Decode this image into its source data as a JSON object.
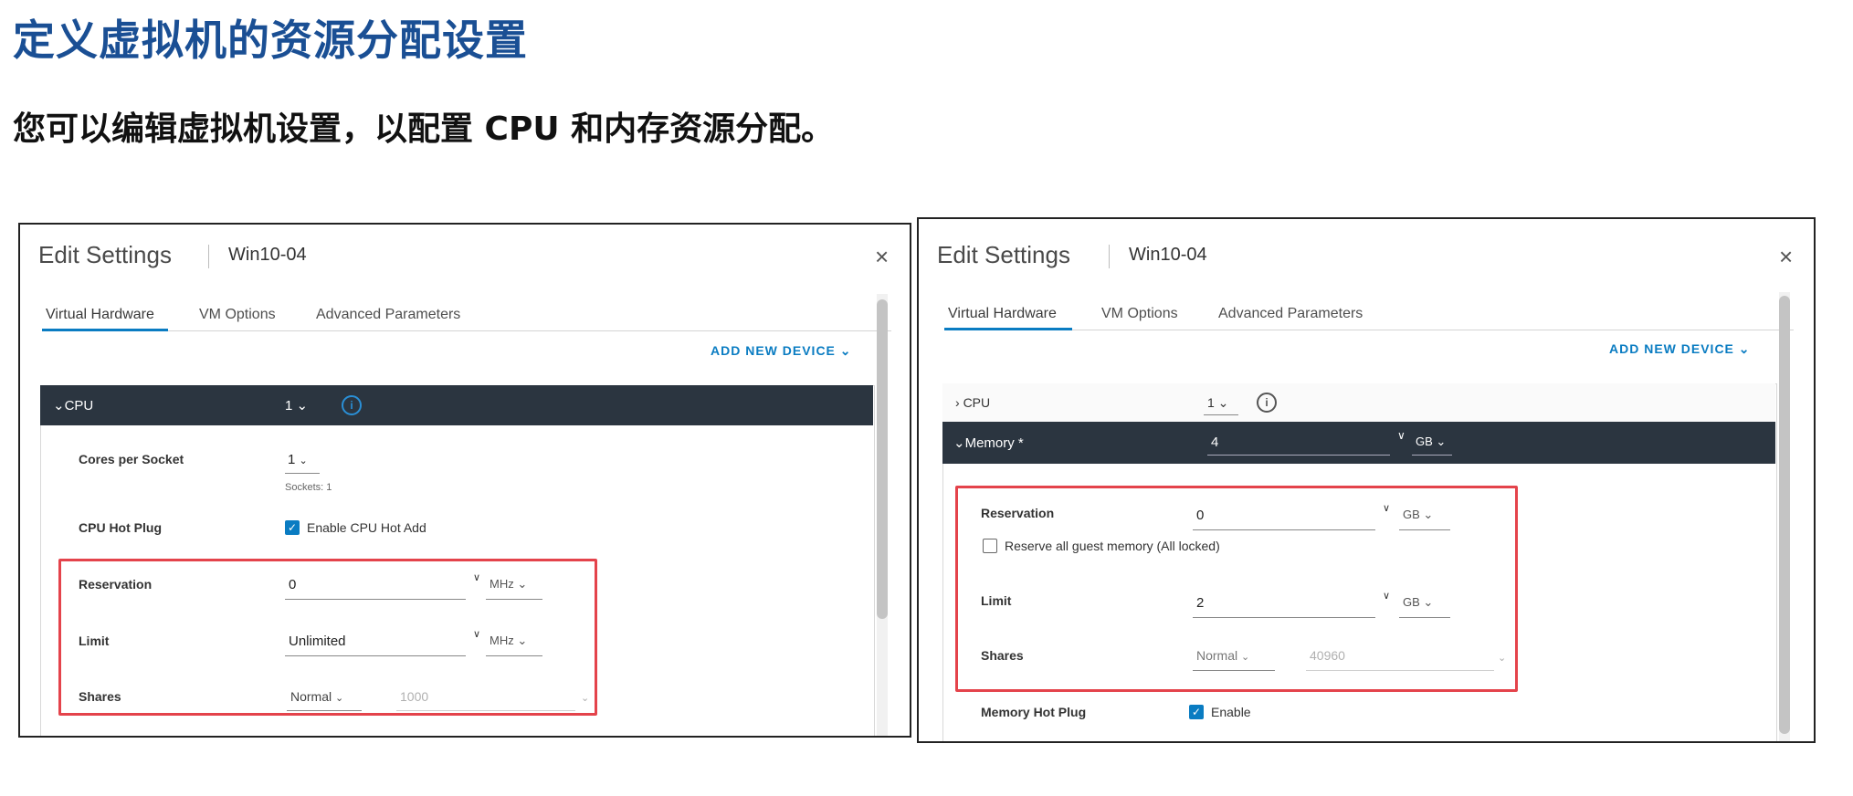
{
  "slide": {
    "title": "定义虚拟机的资源分配设置",
    "subtitle": "您可以编辑虚拟机设置，以配置 CPU 和内存资源分配。"
  },
  "left": {
    "dialog_title": "Edit Settings",
    "vm_name": "Win10-04",
    "close_glyph": "×",
    "tabs": [
      "Virtual Hardware",
      "VM Options",
      "Advanced Parameters"
    ],
    "add_new_device": "ADD NEW DEVICE",
    "cpu": {
      "label": "CPU",
      "value": "1"
    },
    "cores_per_socket": {
      "label": "Cores per Socket",
      "value": "1",
      "sockets": "Sockets: 1"
    },
    "cpu_hot_plug": {
      "label": "CPU Hot Plug",
      "checkbox_label": "Enable CPU Hot Add",
      "checked": true
    },
    "reservation": {
      "label": "Reservation",
      "value": "0",
      "unit": "MHz"
    },
    "limit": {
      "label": "Limit",
      "value": "Unlimited",
      "unit": "MHz"
    },
    "shares": {
      "label": "Shares",
      "value": "Normal",
      "amount": "1000"
    }
  },
  "right": {
    "dialog_title": "Edit Settings",
    "vm_name": "Win10-04",
    "close_glyph": "×",
    "tabs": [
      "Virtual Hardware",
      "VM Options",
      "Advanced Parameters"
    ],
    "add_new_device": "ADD NEW DEVICE",
    "cpu": {
      "label": "CPU",
      "value": "1"
    },
    "memory": {
      "label": "Memory *",
      "value": "4",
      "unit": "GB"
    },
    "reservation": {
      "label": "Reservation",
      "value": "0",
      "unit": "GB",
      "checkbox_label": "Reserve all guest memory (All locked)",
      "checked": false
    },
    "limit": {
      "label": "Limit",
      "value": "2",
      "unit": "GB"
    },
    "shares": {
      "label": "Shares",
      "value": "Normal",
      "amount": "40960"
    },
    "memory_hot_plug": {
      "label": "Memory Hot Plug",
      "checkbox_label": "Enable",
      "checked": true
    }
  },
  "colors": {
    "accent": "#0a7cc2",
    "title_blue": "#1a4f94",
    "highlight_red": "#e4434b",
    "header_dark": "#2b3540"
  }
}
